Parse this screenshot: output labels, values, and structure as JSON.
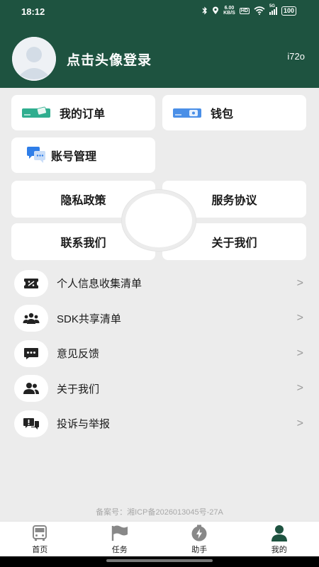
{
  "status_bar": {
    "time": "18:12",
    "speed_value": "6.00",
    "speed_unit": "KB/S",
    "hd_badge": "HD",
    "signal_badge": "5G",
    "battery": "100"
  },
  "profile": {
    "login_prompt": "点击头像登录",
    "user_id": "i72o"
  },
  "cards": {
    "orders": "我的订单",
    "wallet": "钱包",
    "account": "账号管理"
  },
  "grid": {
    "privacy": "隐私政策",
    "service": "服务协议",
    "contact": "联系我们",
    "about": "关于我们"
  },
  "list": [
    {
      "label": "个人信息收集清单",
      "icon": "ticket-icon"
    },
    {
      "label": "SDK共享清单",
      "icon": "people-icon"
    },
    {
      "label": "意见反馈",
      "icon": "chat-icon"
    },
    {
      "label": "关于我们",
      "icon": "users-icon"
    },
    {
      "label": "投诉与举报",
      "icon": "report-icon"
    }
  ],
  "chevron": ">",
  "icp": "备案号：湘ICP备2026013045号-27A",
  "tabs": [
    {
      "label": "首页",
      "icon": "bus-icon"
    },
    {
      "label": "任务",
      "icon": "flag-icon"
    },
    {
      "label": "助手",
      "icon": "lightning-icon"
    },
    {
      "label": "我的",
      "icon": "person-icon"
    }
  ],
  "colors": {
    "header_bg": "#1e5340",
    "page_bg": "#ececec",
    "card_bg": "#ffffff",
    "accent_teal": "#2fae8f",
    "accent_blue": "#4a8fe7"
  }
}
